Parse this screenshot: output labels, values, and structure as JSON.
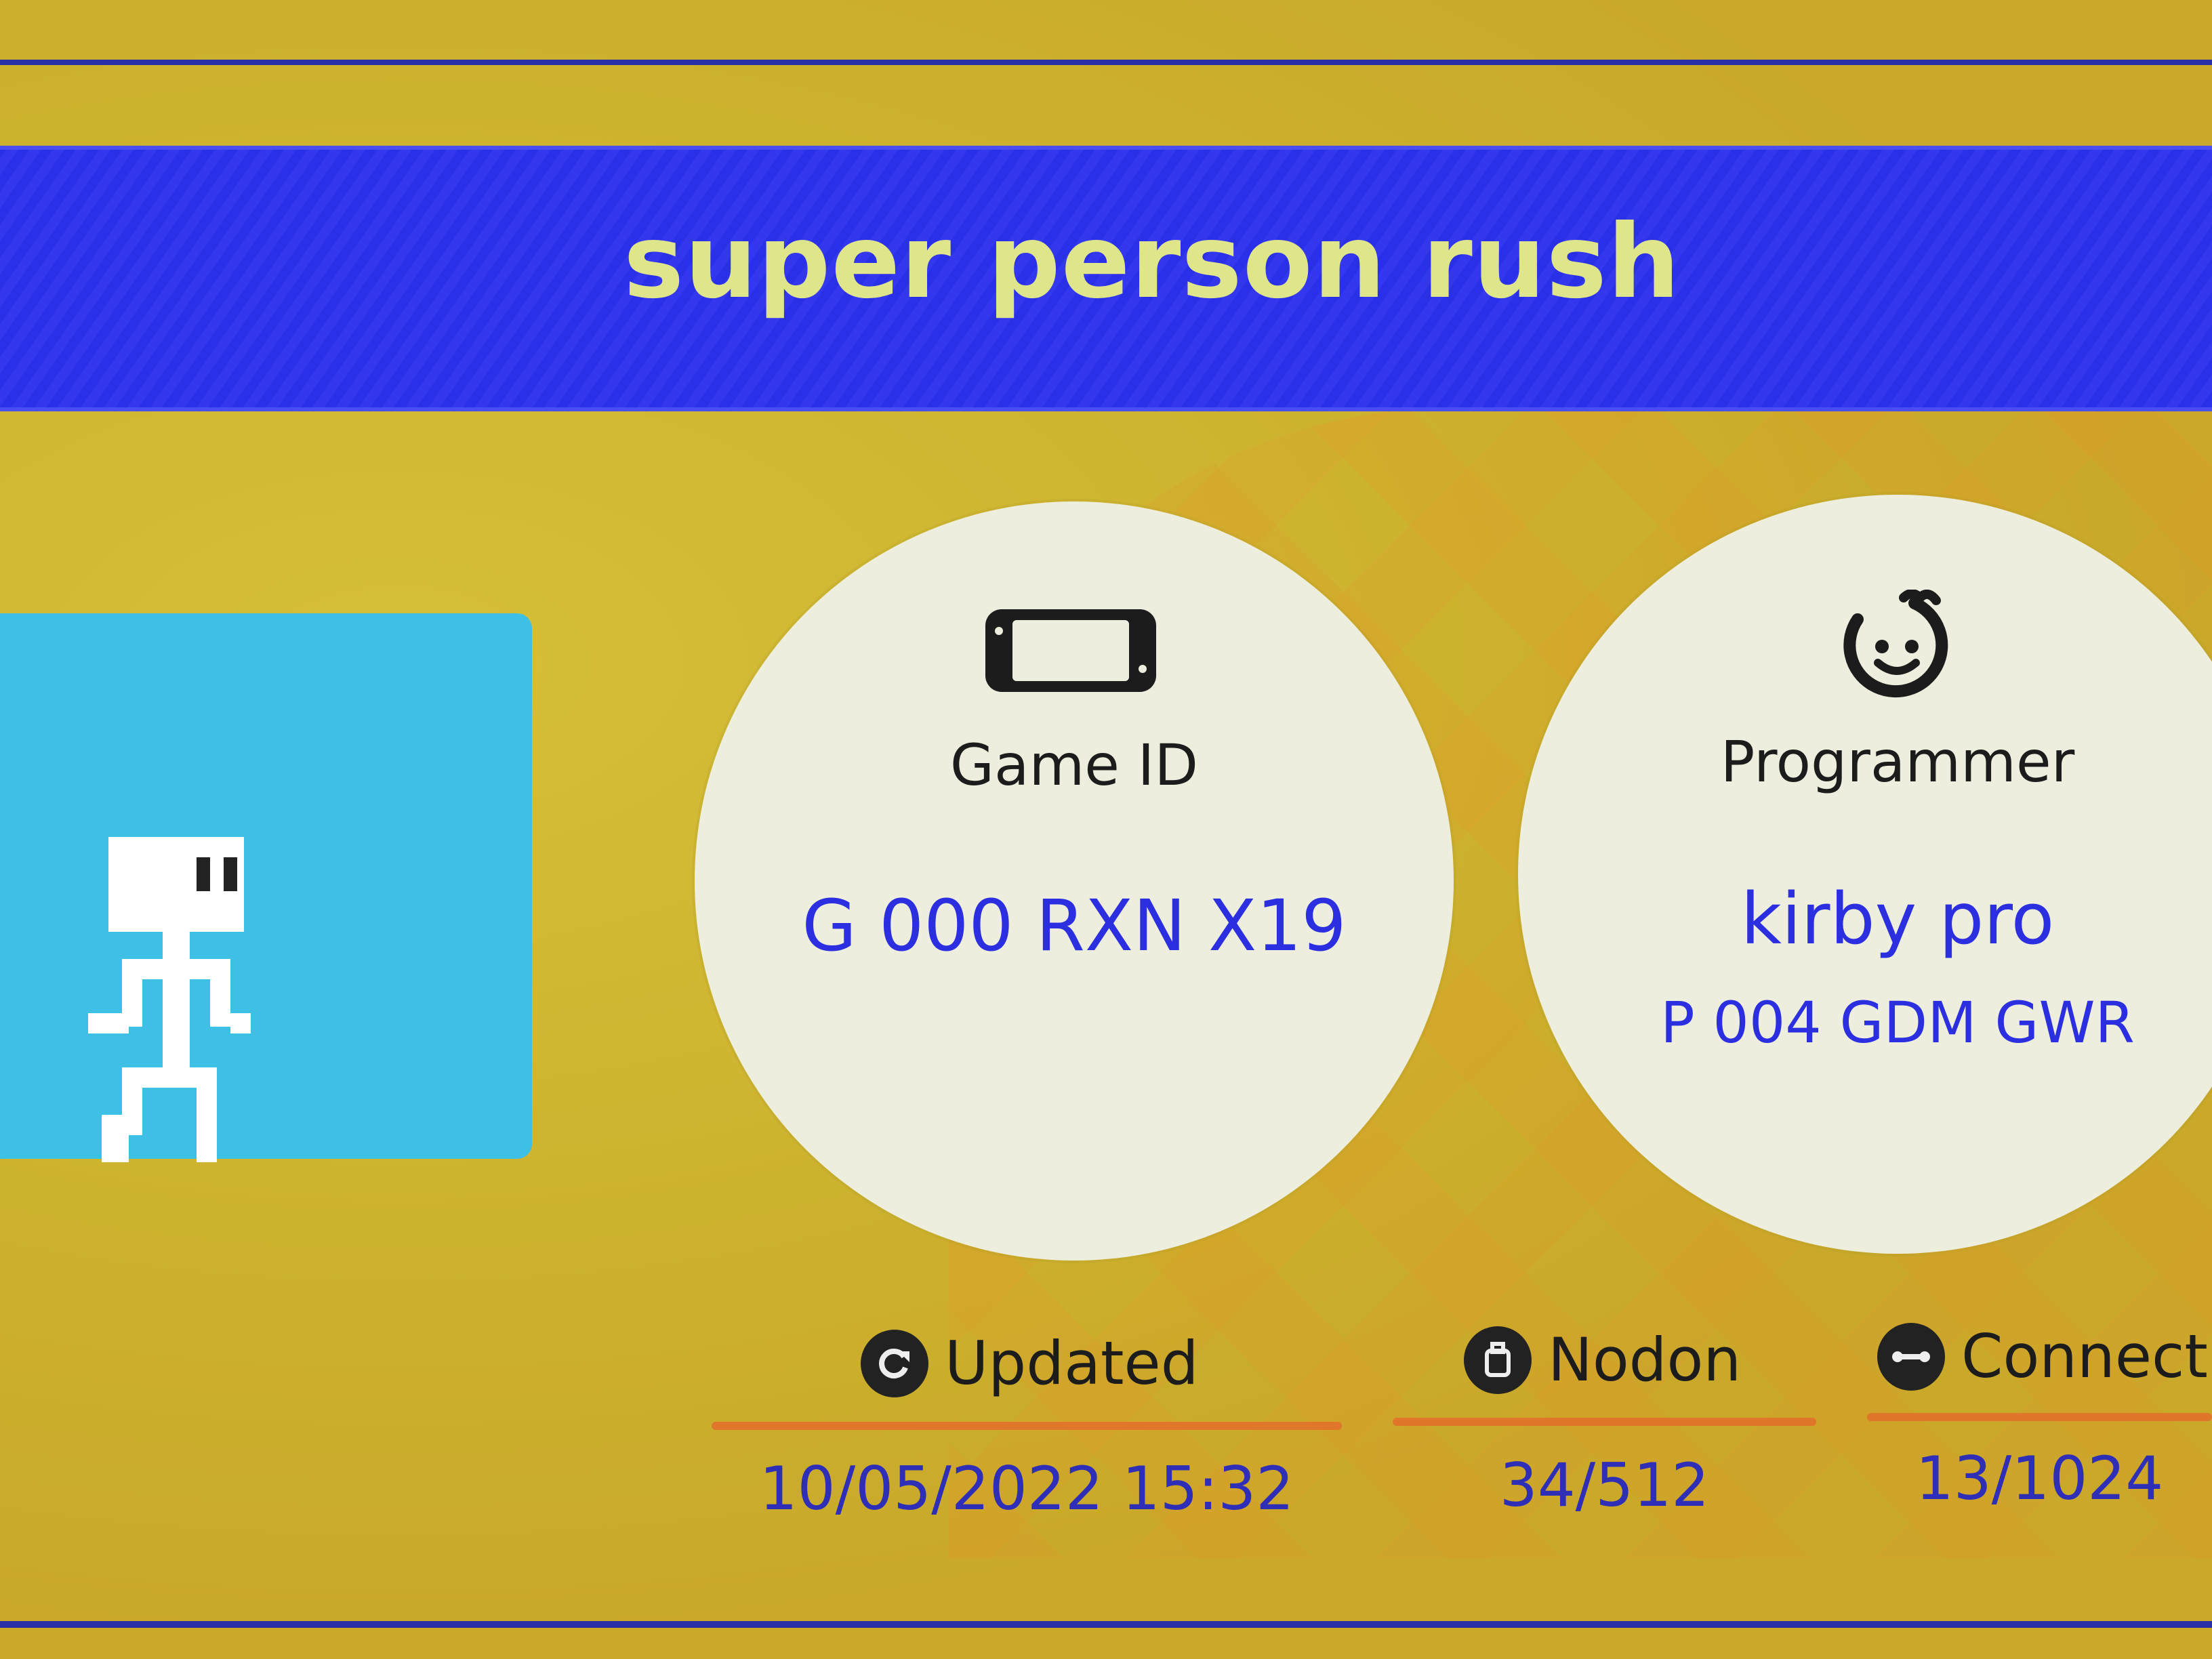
{
  "title": "super person rush",
  "game_id": {
    "label": "Game ID",
    "value": "G 000 RXN X19",
    "icon": "handheld-console-icon"
  },
  "programmer": {
    "label": "Programmer",
    "name": "kirby pro",
    "id": "P 004 GDM GWR",
    "icon": "smiley-face-icon"
  },
  "stats": [
    {
      "label": "Updated",
      "value": "10/05/2022 15:32",
      "icon": "refresh-icon"
    },
    {
      "label": "Nodon",
      "value": "34/512",
      "icon": "nodon-icon"
    },
    {
      "label": "Connectio",
      "value": "13/1024",
      "icon": "connection-icon"
    }
  ],
  "colors": {
    "banner": "#2a2fe8",
    "title_text": "#dfe58a",
    "value_text": "#2b2fe0",
    "background": "#cdb02e",
    "thumbnail": "#3ec0e6",
    "underline": "#e0762a"
  }
}
